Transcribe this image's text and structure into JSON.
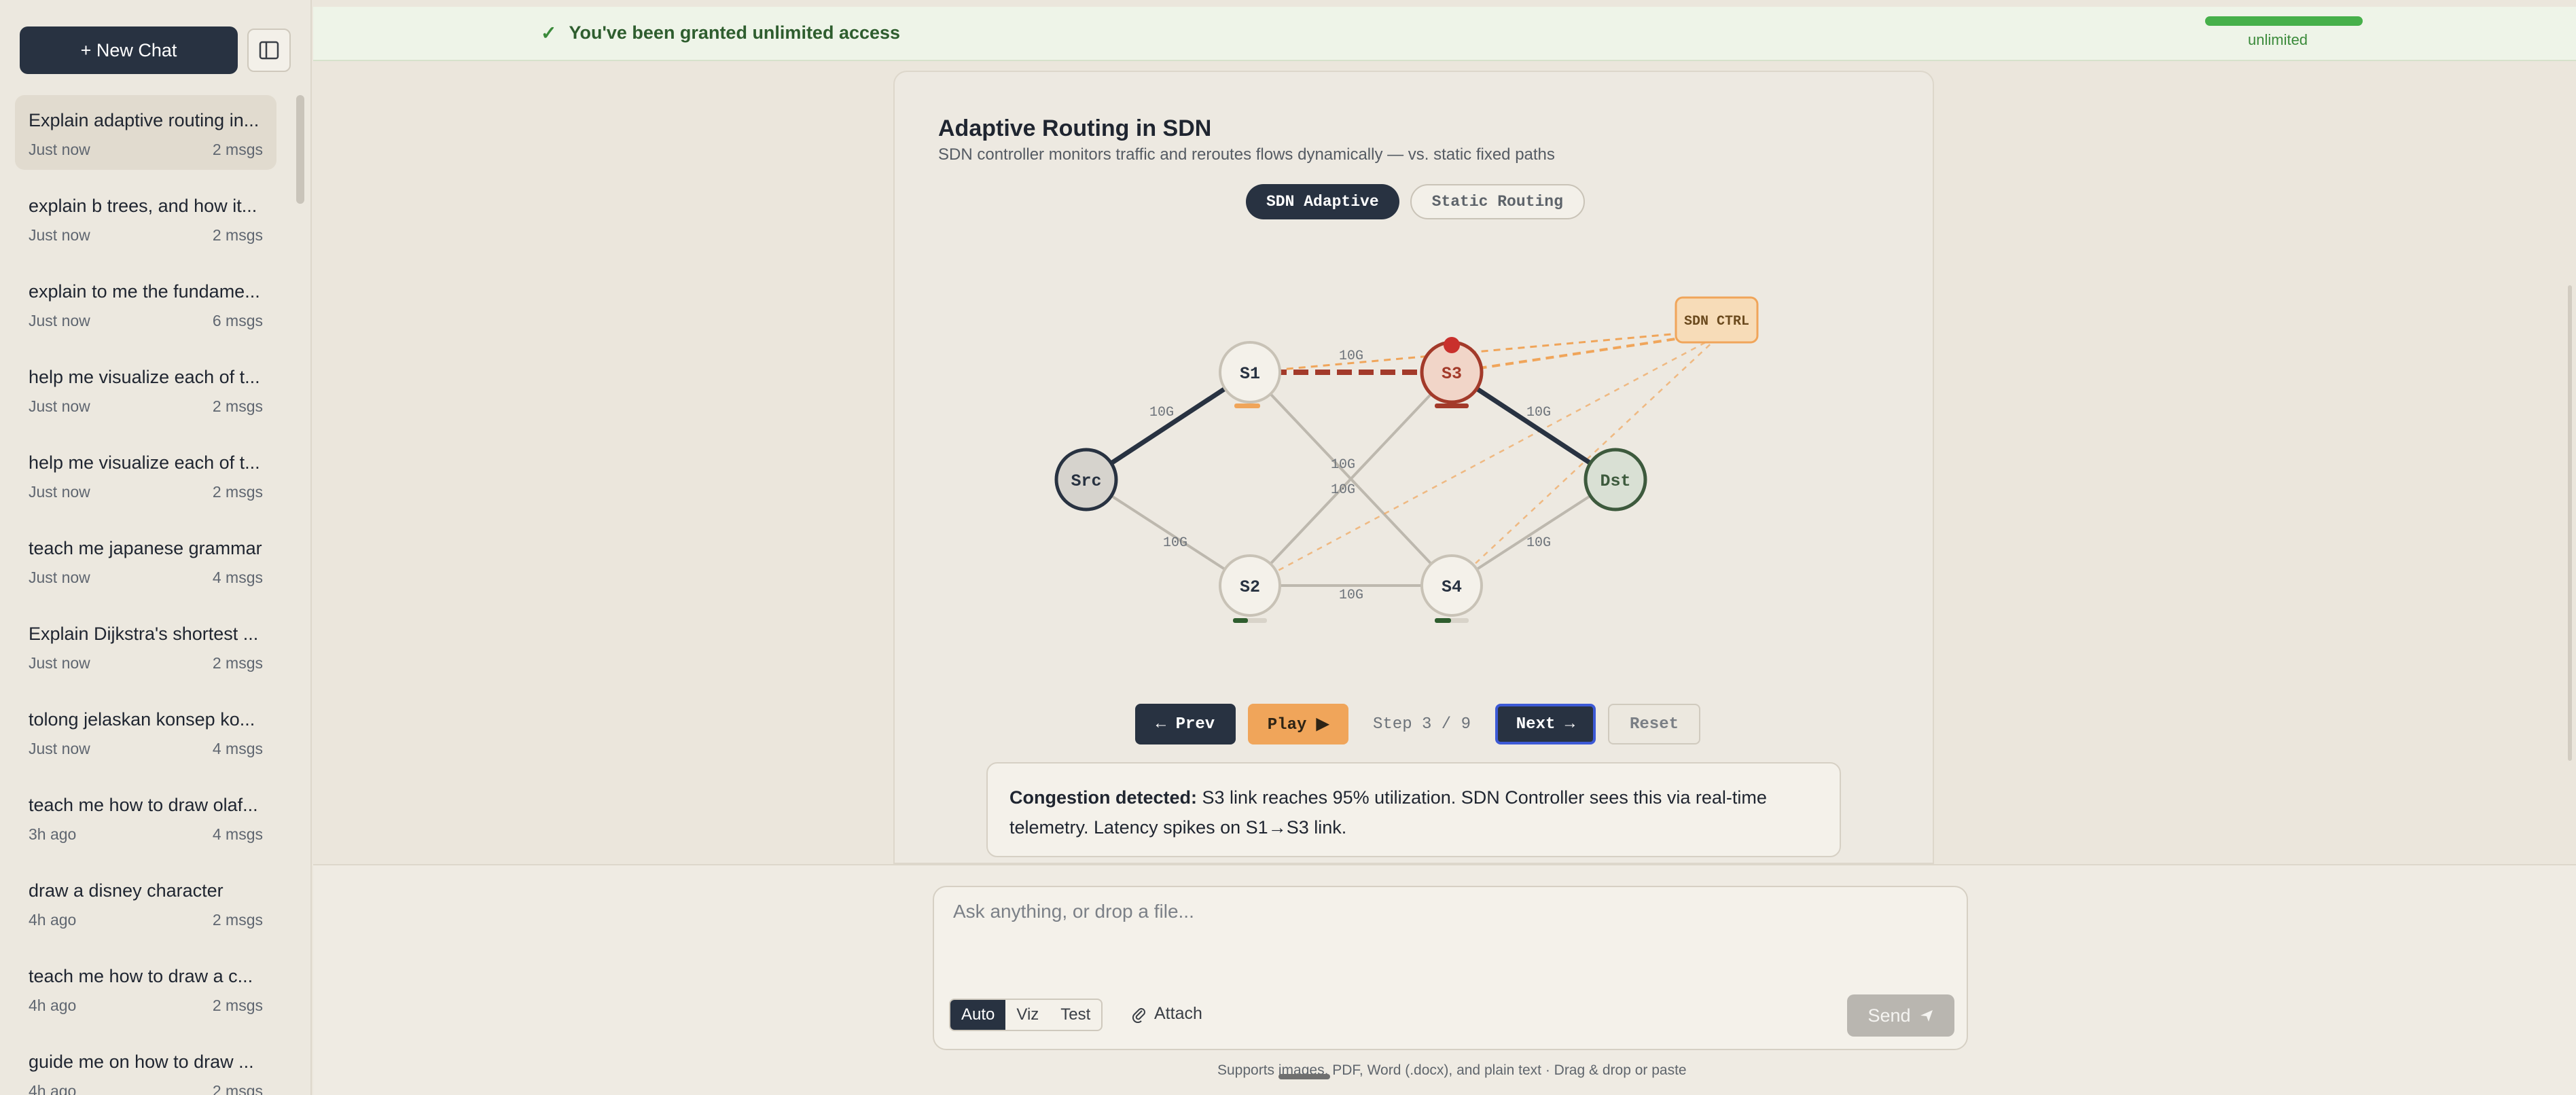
{
  "sidebar": {
    "new_chat": "+ New Chat",
    "chats": [
      {
        "title": "Explain adaptive routing in...",
        "time": "Just now",
        "msgs": "2 msgs"
      },
      {
        "title": "explain b trees, and how it...",
        "time": "Just now",
        "msgs": "2 msgs"
      },
      {
        "title": "explain to me the fundame...",
        "time": "Just now",
        "msgs": "6 msgs"
      },
      {
        "title": "help me visualize each of t...",
        "time": "Just now",
        "msgs": "2 msgs"
      },
      {
        "title": "help me visualize each of t...",
        "time": "Just now",
        "msgs": "2 msgs"
      },
      {
        "title": "teach me japanese grammar",
        "time": "Just now",
        "msgs": "4 msgs"
      },
      {
        "title": "Explain Dijkstra's shortest ...",
        "time": "Just now",
        "msgs": "2 msgs"
      },
      {
        "title": "tolong jelaskan konsep ko...",
        "time": "Just now",
        "msgs": "4 msgs"
      },
      {
        "title": "teach me how to draw olaf...",
        "time": "3h ago",
        "msgs": "4 msgs"
      },
      {
        "title": "draw a disney character",
        "time": "4h ago",
        "msgs": "2 msgs"
      },
      {
        "title": "teach me how to draw a c...",
        "time": "4h ago",
        "msgs": "2 msgs"
      },
      {
        "title": "guide me on how to draw ...",
        "time": "4h ago",
        "msgs": "2 msgs"
      }
    ]
  },
  "banner": {
    "message": "You've been granted unlimited access",
    "usage_label": "unlimited",
    "usage_fraction": 1.0,
    "accent": "#46b04a"
  },
  "viz": {
    "title": "Adaptive Routing in SDN",
    "subtitle": "SDN controller monitors traffic and reroutes flows dynamically — vs. static fixed paths",
    "mode_adaptive": "SDN Adaptive",
    "mode_static": "Static Routing",
    "nodes": {
      "src": "Src",
      "s1": "S1",
      "s2": "S2",
      "s3": "S3",
      "s4": "S4",
      "dst": "Dst",
      "ctrl": "SDN CTRL"
    },
    "link_labels": {
      "src_s1": "10G",
      "s1_s3": "10G",
      "s3_dst": "10G",
      "src_s2": "10G",
      "s2_s4": "10G",
      "s4_dst": "10G",
      "s1_s4": "10G",
      "s2_s3": "10G"
    },
    "controls": {
      "prev": "← Prev",
      "play": "Play ▶",
      "step": "Step 3 / 9",
      "next": "Next →",
      "reset": "Reset"
    },
    "explanation_head": "Congestion detected:",
    "explanation_body": "S3 link reaches 95% utilization. SDN Controller sees this via real-time telemetry. Latency spikes on S1→S3 link.",
    "colors": {
      "congested": "#a33a2a",
      "path": "#283241",
      "controller": "#f0a55a",
      "idle_link": "#bdb8ae"
    }
  },
  "composer": {
    "placeholder": "Ask anything, or drop a file...",
    "modes": [
      "Auto",
      "Viz",
      "Test"
    ],
    "attach": "Attach",
    "send": "Send",
    "footnote": "Supports images, PDF, Word (.docx), and plain text · Drag & drop or paste"
  }
}
